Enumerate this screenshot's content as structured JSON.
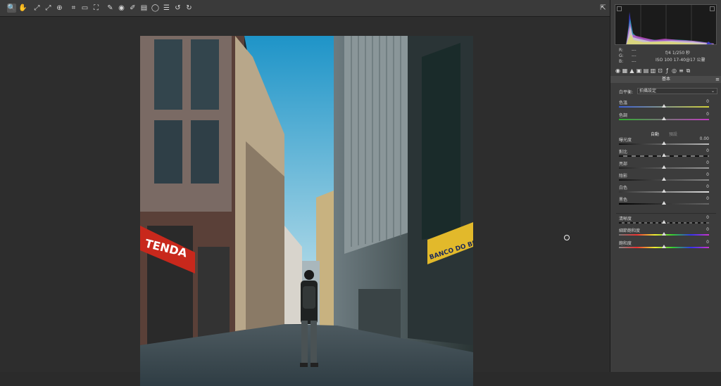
{
  "toolbar": {
    "tools": [
      {
        "name": "zoom-tool",
        "glyph": "🔍",
        "active": true
      },
      {
        "name": "hand-tool",
        "glyph": "✋"
      },
      {
        "name": "white-balance-tool",
        "glyph": "⤢"
      },
      {
        "name": "color-sampler-tool",
        "glyph": "⤢"
      },
      {
        "name": "targeted-adjustment-tool",
        "glyph": "⊕"
      },
      {
        "name": "crop-tool",
        "glyph": "⌗"
      },
      {
        "name": "straighten-tool",
        "glyph": "▭"
      },
      {
        "name": "transform-tool",
        "glyph": "⛶"
      },
      {
        "name": "spot-removal-tool",
        "glyph": "✎"
      },
      {
        "name": "red-eye-tool",
        "glyph": "◉"
      },
      {
        "name": "adjustment-brush-tool",
        "glyph": "✐"
      },
      {
        "name": "graduated-filter-tool",
        "glyph": "▤"
      },
      {
        "name": "radial-filter-tool",
        "glyph": "◯"
      },
      {
        "name": "preferences-tool",
        "glyph": "☰"
      },
      {
        "name": "rotate-left-tool",
        "glyph": "↺"
      },
      {
        "name": "rotate-right-tool",
        "glyph": "↻"
      }
    ],
    "export_glyph": "⇱"
  },
  "histogram": {
    "r_label": "R:",
    "g_label": "G:",
    "b_label": "B:",
    "r_value": "---",
    "g_value": "---",
    "b_value": "---",
    "aperture_shutter": "f/4   1/250 秒",
    "iso_lens": "ISO 100   17-40@17 公釐"
  },
  "panel": {
    "section_title": "基本",
    "tabs": [
      "basic-icon",
      "tone-curve-icon",
      "detail-icon",
      "hsl-icon",
      "split-toning-icon",
      "lens-icon",
      "transform-icon",
      "effects-icon",
      "camera-calibration-icon",
      "presets-icon",
      "snapshots-icon"
    ],
    "wb_label": "白平衡:",
    "wb_value": "拍攝設定",
    "auto_label": "自動",
    "default_label": "預設",
    "sliders": {
      "temperature": {
        "label": "色溫",
        "value": "0",
        "pos": 0.5,
        "gradient": "linear-gradient(to right,#3b5fd6,#cfcf3a)"
      },
      "tint": {
        "label": "色調",
        "value": "0",
        "pos": 0.5,
        "gradient": "linear-gradient(to right,#2fb02f,#c03ac0)"
      },
      "exposure": {
        "label": "曝光度",
        "value": "0.00",
        "pos": 0.5,
        "gradient": "linear-gradient(to right,#111,#bbb)"
      },
      "contrast": {
        "label": "對比",
        "value": "0",
        "pos": 0.5,
        "gradient": "repeating-linear-gradient(to right,#111 0 6px,#777 6px 12px)"
      },
      "highlights": {
        "label": "亮部",
        "value": "0",
        "pos": 0.5,
        "gradient": "linear-gradient(to right,#222,#999)"
      },
      "shadows": {
        "label": "陰影",
        "value": "0",
        "pos": 0.5,
        "gradient": "linear-gradient(to right,#111,#888)"
      },
      "whites": {
        "label": "白色",
        "value": "0",
        "pos": 0.5,
        "gradient": "linear-gradient(to right,#333,#ddd)"
      },
      "blacks": {
        "label": "黑色",
        "value": "0",
        "pos": 0.5,
        "gradient": "linear-gradient(to right,#000,#666)"
      },
      "clarity": {
        "label": "清晰度",
        "value": "0",
        "pos": 0.5,
        "gradient": "repeating-linear-gradient(to right,#111 0 4px,#666 4px 8px)"
      },
      "vibrance": {
        "label": "細節飽和度",
        "value": "0",
        "pos": 0.5,
        "gradient": "linear-gradient(to right,#777,#e33,#ee3,#3c3,#33e,#c3c)"
      },
      "saturation": {
        "label": "飽和度",
        "value": "0",
        "pos": 0.5,
        "gradient": "linear-gradient(to right,#888,#e33,#ee3,#3c3,#33e,#c3c)"
      }
    }
  },
  "photo": {
    "sign_left": "TENDA",
    "sign_right": "BANCO DO BRASIL"
  },
  "colors": {
    "sky": "#3fa8d8",
    "sign_red": "#c8281c",
    "sign_yellow": "#e2b92b",
    "panel_bg": "#3c3c3c",
    "canvas_bg": "#2d2d2d"
  }
}
